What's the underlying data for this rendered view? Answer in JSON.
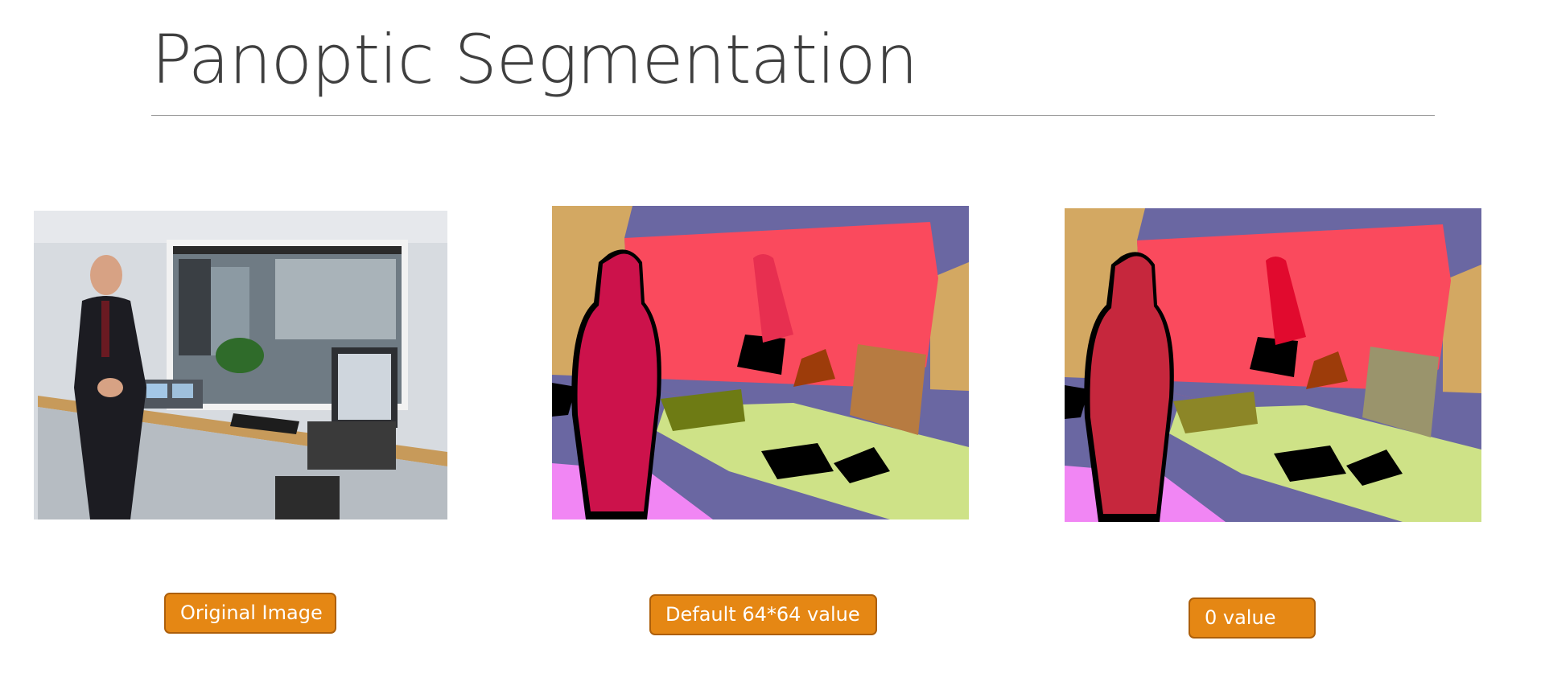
{
  "slide": {
    "title": "Panoptic Segmentation"
  },
  "panels": [
    {
      "name": "original-image",
      "label": "Original Image",
      "content": "photo"
    },
    {
      "name": "default-segmentation",
      "label": "Default 64*64 value",
      "content": "segmentation-map"
    },
    {
      "name": "zero-segmentation",
      "label": "0 value",
      "content": "segmentation-map"
    }
  ],
  "colors": {
    "label_fill": "#e58714",
    "label_border": "#ad5f0a",
    "title_text": "#3f3f3f",
    "wall": "#fa4a5d",
    "ceiling": "#6a67a2",
    "left_wall": "#d3a862",
    "desk": "#cee287",
    "floor": "#f186f4",
    "person_default": "#cc124b",
    "person_zero": "#c6273d",
    "chair_default": "#6e7b14",
    "chair_zero": "#8c8627",
    "monitor_default": "#b77b41",
    "monitor_zero": "#9a946c"
  }
}
